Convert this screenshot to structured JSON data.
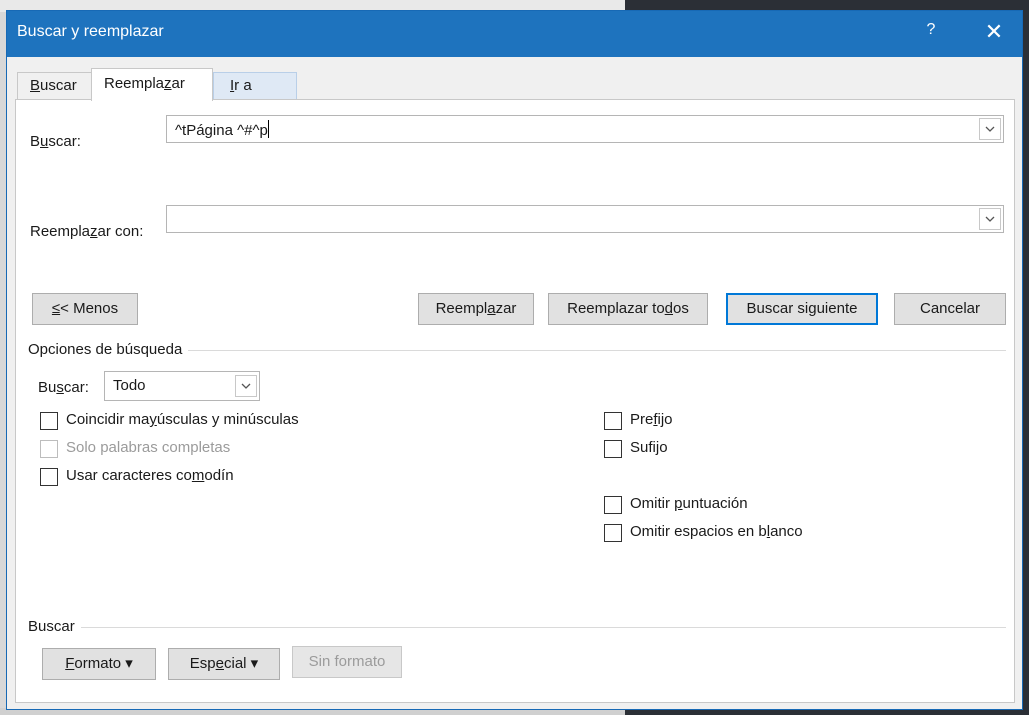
{
  "dialog": {
    "title": "Buscar y reemplazar",
    "help": "?",
    "close": "✕"
  },
  "tabs": [
    {
      "pre": "",
      "key": "B",
      "post": "uscar"
    },
    {
      "pre": "Reempla",
      "key": "z",
      "post": "ar"
    },
    {
      "pre": "",
      "key": "I",
      "post": "r a"
    }
  ],
  "find": {
    "label_pre": "B",
    "label_key": "u",
    "label_post": "scar:",
    "value": "^tPágina ^#^p"
  },
  "replace": {
    "label_pre": "Reempla",
    "label_key": "z",
    "label_post": "ar con:",
    "value": ""
  },
  "buttons": {
    "less_key": "≤",
    "less_post": "< Menos",
    "replace_pre": "Reempl",
    "replace_key": "a",
    "replace_post": "zar",
    "replace_all_pre": "Reemplazar to",
    "replace_all_key": "d",
    "replace_all_post": "os",
    "find_next_pre": "Buscar si",
    "find_next_key": "g",
    "find_next_post": "uiente",
    "cancel": "Cancelar"
  },
  "options": {
    "title": "Opciones de búsqueda",
    "search_label_pre": "Bu",
    "search_label_key": "s",
    "search_label_post": "car:",
    "search_value": "Todo",
    "match_case_pre": "Coincidir ma",
    "match_case_key": "y",
    "match_case_post": "úsculas y minúsculas",
    "whole_words": "Solo palabras completas",
    "wildcards_pre": "Usar caracteres co",
    "wildcards_key": "m",
    "wildcards_post": "odín",
    "prefix_pre": "Pre",
    "prefix_key": "f",
    "prefix_post": "ijo",
    "suffix_pre": "Sufi",
    "suffix_key": "j",
    "suffix_post": "o",
    "ignore_punct_pre": "Omitir ",
    "ignore_punct_key": "p",
    "ignore_punct_post": "untuación",
    "ignore_space_pre": "Omitir espacios en b",
    "ignore_space_key": "l",
    "ignore_space_post": "anco"
  },
  "find_section": {
    "title": "Buscar",
    "format_key": "F",
    "format_post": "ormato ▾",
    "special_pre": "Esp",
    "special_key": "e",
    "special_post": "cial ▾",
    "no_format": "Sin formato"
  },
  "colors": {
    "titlebar": "#1e73be",
    "accent": "#0078d7"
  }
}
